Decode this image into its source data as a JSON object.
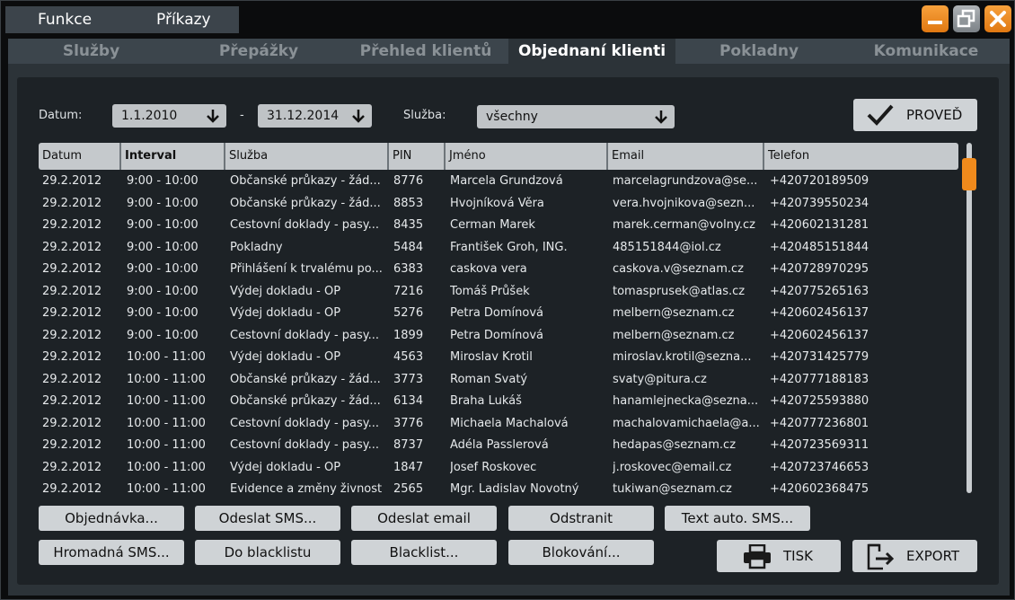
{
  "menu": [
    "Funkce",
    "Příkazy"
  ],
  "tabs": [
    "Služby",
    "Přepážky",
    "Přehled klientů",
    "Objednaní klienti",
    "Pokladny",
    "Komunikace"
  ],
  "filters": {
    "datum_label": "Datum:",
    "date_from": "1.1.2010",
    "dash": "-",
    "date_to": "31.12.2014",
    "sluzba_label": "Služba:",
    "sluzba_value": "všechny",
    "proved_label": "PROVEĎ"
  },
  "table": {
    "columns": [
      "Datum",
      "Interval",
      "Služba",
      "PIN",
      "Jméno",
      "Email",
      "Telefon"
    ],
    "rows": [
      [
        "29.2.2012",
        "9:00 - 10:00",
        "Občanské průkazy - žád...",
        "8776",
        "Marcela Grundzová",
        "marcelagrundzova@se...",
        "+420720189509"
      ],
      [
        "29.2.2012",
        "9:00 - 10:00",
        "Občanské průkazy - žád...",
        "8853",
        "Hvojníková Věra",
        "vera.hvojnikova@sezn...",
        "+420739550234"
      ],
      [
        "29.2.2012",
        "9:00 - 10:00",
        "Cestovní doklady - pasy...",
        "8435",
        "Cerman Marek",
        "marek.cerman@volny.cz",
        "+420602131281"
      ],
      [
        "29.2.2012",
        "9:00 - 10:00",
        "Pokladny",
        "5484",
        "František Groh, ING.",
        "485151844@iol.cz",
        "+420485151844"
      ],
      [
        "29.2.2012",
        "9:00 - 10:00",
        "Přihlášení k trvalému po...",
        "6383",
        "caskova vera",
        "caskova.v@seznam.cz",
        "+420728970295"
      ],
      [
        "29.2.2012",
        "9:00 - 10:00",
        "Výdej dokladu - OP",
        "7216",
        "Tomáš Průšek",
        "tomasprusek@atlas.cz",
        "+420775265163"
      ],
      [
        "29.2.2012",
        "9:00 - 10:00",
        "Výdej dokladu - OP",
        "5276",
        "Petra Domínová",
        "melbern@seznam.cz",
        "+420602456137"
      ],
      [
        "29.2.2012",
        "9:00 - 10:00",
        "Cestovní doklady - pasy...",
        "1899",
        "Petra Domínová",
        "melbern@seznam.cz",
        "+420602456137"
      ],
      [
        "29.2.2012",
        "10:00 - 11:00",
        "Výdej dokladu - OP",
        "4563",
        "Miroslav Krotil",
        "miroslav.krotil@sezna...",
        "+420731425779"
      ],
      [
        "29.2.2012",
        "10:00 - 11:00",
        "Občanské průkazy - žád...",
        "3773",
        "Roman Svatý",
        "svaty@pitura.cz",
        "+420777188183"
      ],
      [
        "29.2.2012",
        "10:00 - 11:00",
        "Občanské průkazy - žád...",
        "6134",
        "Braha Lukáš",
        "hanamlejnecka@sezna...",
        "+420725593880"
      ],
      [
        "29.2.2012",
        "10:00 - 11:00",
        "Cestovní doklady - pasy...",
        "3776",
        "Michaela Machalová",
        "machalovamichaela@a...",
        "+420777236801"
      ],
      [
        "29.2.2012",
        "10:00 - 11:00",
        "Cestovní doklady - pasy...",
        "8737",
        "Adéla Passlerová",
        "hedapas@seznam.cz",
        "+420723569311"
      ],
      [
        "29.2.2012",
        "10:00 - 11:00",
        "Výdej dokladu - OP",
        "1847",
        "Josef Roskovec",
        "j.roskovec@email.cz",
        "+420723746653"
      ],
      [
        "29.2.2012",
        "10:00 - 11:00",
        "Evidence a změny živností",
        "2565",
        "Mgr. Ladislav Novotný",
        "tukiwan@seznam.cz",
        "+420602368475"
      ]
    ]
  },
  "actions_row1": [
    "Objednávka...",
    "Odeslat SMS...",
    "Odeslat email",
    "Odstranit",
    "Text auto. SMS..."
  ],
  "actions_row2": [
    "Hromadná SMS...",
    "Do blacklistu",
    "Blacklist...",
    "Blokování..."
  ],
  "tisk_label": "TISK",
  "export_label": "EXPORT",
  "colors": {
    "accent": "#f08a1c",
    "background": "#2c3338",
    "grid_bg": "#1d2226"
  }
}
